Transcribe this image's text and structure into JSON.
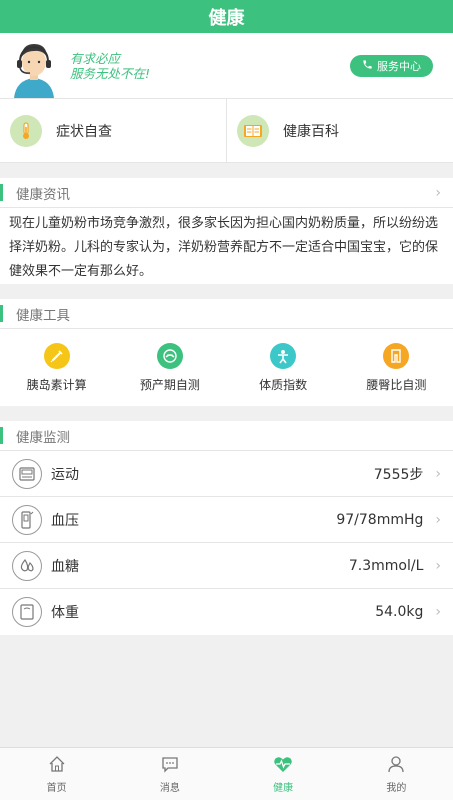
{
  "header": {
    "title": "健康"
  },
  "service": {
    "slogan_line1": "有求必应",
    "slogan_line2": "服务无处不在!",
    "button_label": "服务中心",
    "icon": "phone-icon"
  },
  "quick": [
    {
      "label": "症状自查",
      "icon": "thermometer-icon"
    },
    {
      "label": "健康百科",
      "icon": "book-icon"
    }
  ],
  "news": {
    "title": "健康资讯",
    "body": "现在儿童奶粉市场竞争激烈，很多家长因为担心国内奶粉质量，所以纷纷选择洋奶粉。儿科的专家认为，洋奶粉营养配方不一定适合中国宝宝，它的保健效果不一定有那么好。"
  },
  "tools": {
    "title": "健康工具",
    "items": [
      {
        "label": "胰岛素计算",
        "icon": "syringe-icon",
        "color": "#f5c518"
      },
      {
        "label": "预产期自测",
        "icon": "baby-icon",
        "color": "#3dc17f"
      },
      {
        "label": "体质指数",
        "icon": "person-icon",
        "color": "#3cc8c8"
      },
      {
        "label": "腰臀比自测",
        "icon": "pants-icon",
        "color": "#f5a623"
      }
    ]
  },
  "monitor": {
    "title": "健康监测",
    "rows": [
      {
        "label": "运动",
        "value": "7555步",
        "icon": "pedometer-icon"
      },
      {
        "label": "血压",
        "value": "97/78mmHg",
        "icon": "blood-pressure-icon"
      },
      {
        "label": "血糖",
        "value": "7.3mmol/L",
        "icon": "blood-drop-icon"
      },
      {
        "label": "体重",
        "value": "54.0kg",
        "icon": "scale-icon"
      }
    ]
  },
  "tabs": [
    {
      "label": "首页",
      "icon": "home-icon"
    },
    {
      "label": "消息",
      "icon": "message-icon"
    },
    {
      "label": "健康",
      "icon": "heart-pulse-icon",
      "active": true
    },
    {
      "label": "我的",
      "icon": "user-icon"
    }
  ],
  "colors": {
    "accent": "#3dc17f"
  }
}
